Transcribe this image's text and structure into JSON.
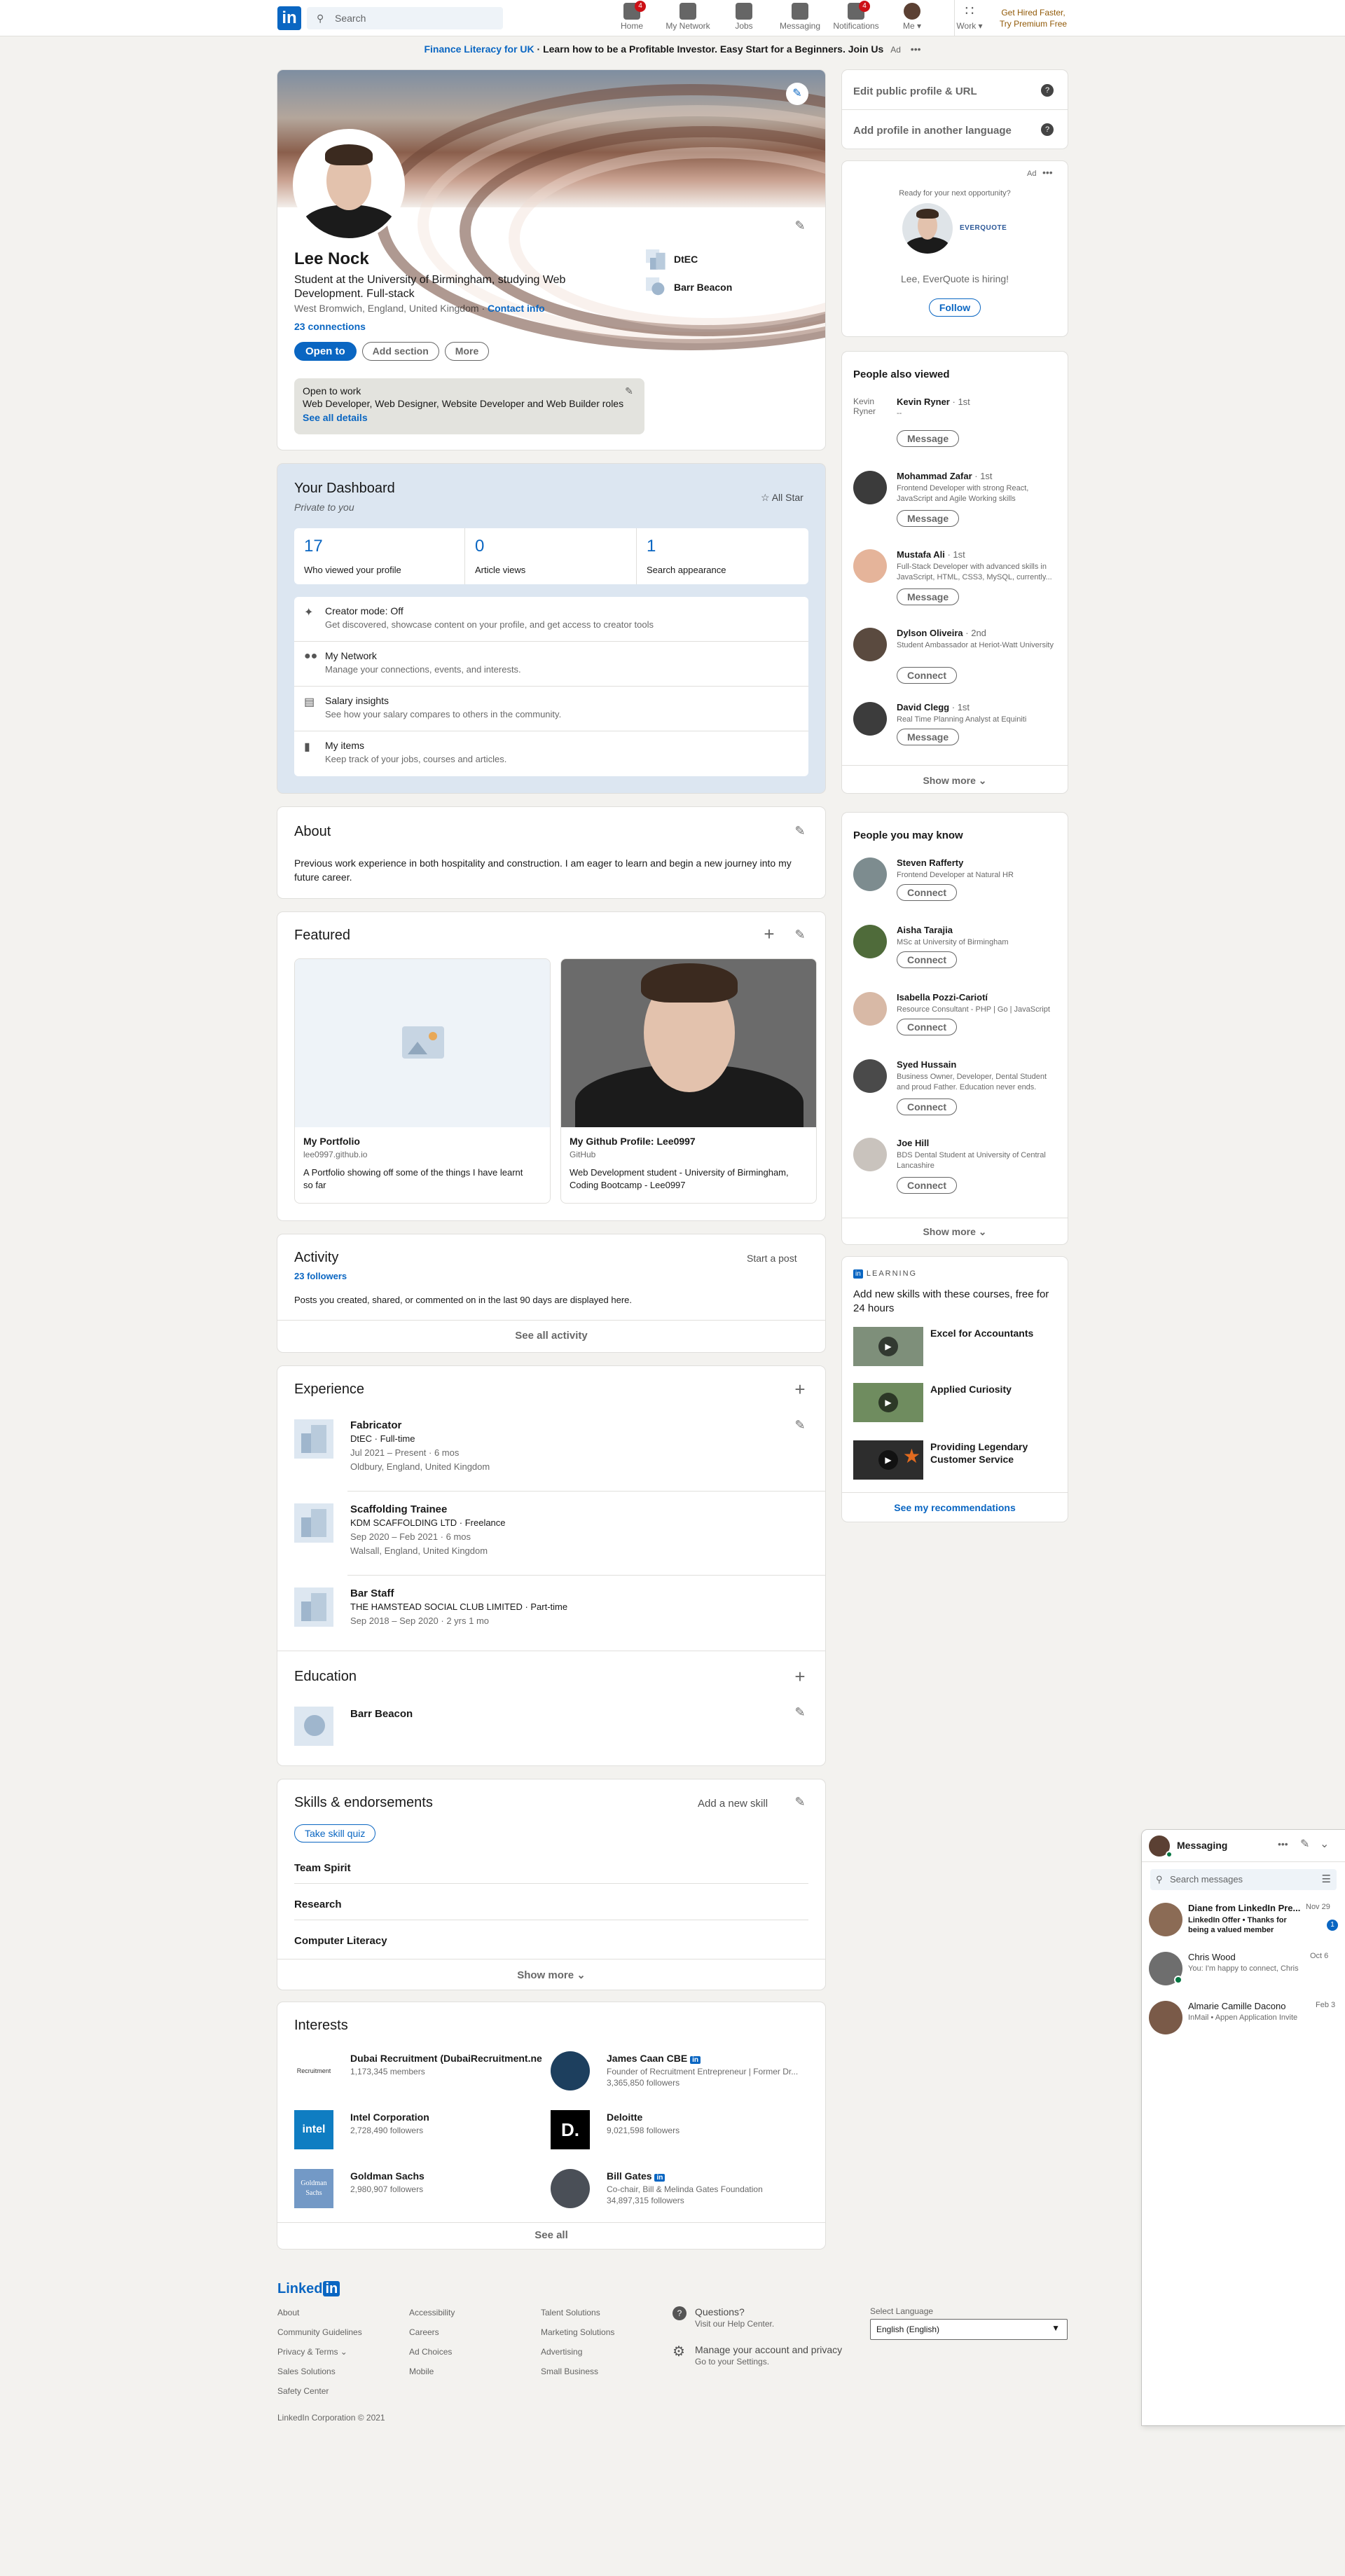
{
  "nav": {
    "search_placeholder": "Search",
    "items": [
      {
        "label": "Home",
        "badge": "4"
      },
      {
        "label": "My Network",
        "badge": ""
      },
      {
        "label": "Jobs",
        "badge": ""
      },
      {
        "label": "Messaging",
        "badge": ""
      },
      {
        "label": "Notifications",
        "badge": "4"
      },
      {
        "label": "Me ▾",
        "badge": ""
      },
      {
        "label": "Work ▾",
        "badge": ""
      }
    ],
    "premium": "Get Hired Faster, Try Premium Free"
  },
  "ad_banner": {
    "link": "Finance Literacy for UK",
    "text": " · Learn how to be a Profitable Investor. Easy Start for a Beginners. Join Us",
    "tag": "Ad",
    "more": "•••"
  },
  "profile": {
    "name": "Lee Nock",
    "headline": "Student at the University of Birmingham, studying Web Development. Full-stack",
    "location": "West Bromwich, England, United Kingdom",
    "contact_info": "Contact info",
    "connections": "23 connections",
    "open_to_btn": "Open to",
    "add_section_btn": "Add section",
    "more_btn": "More",
    "companies": [
      "DtEC",
      "Barr Beacon"
    ],
    "open_to_work": {
      "title": "Open to work",
      "roles": "Web Developer, Web Designer, Website Developer and Web Builder roles",
      "link": "See all details"
    }
  },
  "dashboard": {
    "title": "Your Dashboard",
    "subtitle": "Private to you",
    "all_star": "All Star",
    "stats": [
      {
        "value": "17",
        "label": "Who viewed your profile"
      },
      {
        "value": "0",
        "label": "Article views"
      },
      {
        "value": "1",
        "label": "Search appearance"
      }
    ],
    "items": [
      {
        "title": "Creator mode: Off",
        "desc": "Get discovered, showcase content on your profile, and get access to creator tools"
      },
      {
        "title": "My Network",
        "desc": "Manage your connections, events, and interests."
      },
      {
        "title": "Salary insights",
        "desc": "See how your salary compares to others in the community."
      },
      {
        "title": "My items",
        "desc": "Keep track of your jobs, courses and articles."
      }
    ]
  },
  "about": {
    "title": "About",
    "text": "Previous work experience in both hospitality and construction. I am eager to learn and begin a new journey into my future career."
  },
  "featured": {
    "title": "Featured",
    "items": [
      {
        "title": "My Portfolio",
        "source": "lee0997.github.io",
        "desc": "A Portfolio showing off some of the things I have learnt so far"
      },
      {
        "title": "My Github Profile: Lee0997",
        "source": "GitHub",
        "desc": "Web Development student - University of Birmingham, Coding Bootcamp - Lee0997"
      }
    ]
  },
  "activity": {
    "title": "Activity",
    "followers": "23 followers",
    "start_post": "Start a post",
    "desc": "Posts you created, shared, or commented on in the last 90 days are displayed here.",
    "see_all": "See all activity"
  },
  "experience": {
    "title": "Experience",
    "items": [
      {
        "role": "Fabricator",
        "company": "DtEC · Full-time",
        "dates": "Jul 2021 – Present · 6 mos",
        "location": "Oldbury, England, United Kingdom"
      },
      {
        "role": "Scaffolding Trainee",
        "company": "KDM SCAFFOLDING LTD · Freelance",
        "dates": "Sep 2020 – Feb 2021 · 6 mos",
        "location": "Walsall, England, United Kingdom"
      },
      {
        "role": "Bar Staff",
        "company": "THE HAMSTEAD SOCIAL CLUB LIMITED · Part-time",
        "dates": "Sep 2018 – Sep 2020 · 2 yrs 1 mo",
        "location": ""
      }
    ]
  },
  "education": {
    "title": "Education",
    "items": [
      {
        "school": "Barr Beacon"
      }
    ]
  },
  "skills": {
    "title": "Skills & endorsements",
    "add_skill": "Add a new skill",
    "quiz_btn": "Take skill quiz",
    "items": [
      "Team Spirit",
      "Research",
      "Computer Literacy"
    ],
    "show_more": "Show more ⌄"
  },
  "interests": {
    "title": "Interests",
    "items": [
      {
        "name": "Dubai Recruitment (DubaiRecruitment.ne",
        "sub": "1,173,345 members",
        "sub2": "",
        "logo_text": "Recruitment",
        "color": "#ffffff"
      },
      {
        "name": "James Caan CBE",
        "sub": "Founder of Recruitment Entrepreneur | Former Dr...",
        "sub2": "3,365,850 followers",
        "logo_text": "",
        "color": "#1d3f5e"
      },
      {
        "name": "Intel Corporation",
        "sub": "2,728,490 followers",
        "sub2": "",
        "logo_text": "intel",
        "color": "#0f7dc2"
      },
      {
        "name": "Deloitte",
        "sub": "9,021,598 followers",
        "sub2": "",
        "logo_text": "D.",
        "color": "#000000"
      },
      {
        "name": "Goldman Sachs",
        "sub": "2,980,907 followers",
        "sub2": "",
        "logo_text": "Goldman Sachs",
        "color": "#7399c6"
      },
      {
        "name": "Bill Gates",
        "sub": "Co-chair, Bill & Melinda Gates Foundation",
        "sub2": "34,897,315 followers",
        "logo_text": "",
        "color": "#4a4f57"
      }
    ],
    "see_all": "See all"
  },
  "sidebar": {
    "edit_links": [
      "Edit public profile & URL",
      "Add profile in another language"
    ],
    "ad": {
      "tag": "Ad",
      "more": "•••",
      "prompt": "Ready for your next opportunity?",
      "company_logo": "EVERQUOTE",
      "text": "Lee, EverQuote is hiring!",
      "follow": "Follow"
    },
    "people_also_viewed": {
      "title": "People also viewed",
      "people": [
        {
          "name": "Kevin Ryner",
          "degree": "· 1st",
          "desc": "--",
          "btn": "Message",
          "alt": "Kevin Ryner"
        },
        {
          "name": "Mohammad Zafar",
          "degree": "· 1st",
          "desc": "Frontend Developer with strong React, JavaScript and Agile Working skills",
          "btn": "Message",
          "alt": ""
        },
        {
          "name": "Mustafa Ali",
          "degree": "· 1st",
          "desc": "Full-Stack Developer with advanced skills in JavaScript, HTML, CSS3, MySQL, currently...",
          "btn": "Message",
          "alt": ""
        },
        {
          "name": "Dylson Oliveira",
          "degree": "· 2nd",
          "desc": "Student Ambassador at Heriot-Watt University",
          "btn": "Connect",
          "alt": ""
        },
        {
          "name": "David Clegg",
          "degree": "· 1st",
          "desc": "Real Time Planning Analyst at Equiniti",
          "btn": "Message",
          "alt": ""
        }
      ],
      "show_more": "Show more ⌄"
    },
    "people_you_may_know": {
      "title": "People you may know",
      "people": [
        {
          "name": "Steven Rafferty",
          "desc": "Frontend Developer at Natural HR",
          "btn": "Connect"
        },
        {
          "name": "Aisha Tarajia",
          "desc": "MSc at University of Birmingham",
          "btn": "Connect"
        },
        {
          "name": "Isabella Pozzi-Cariotí",
          "desc": "Resource Consultant - PHP | Go | JavaScript",
          "btn": "Connect"
        },
        {
          "name": "Syed Hussain",
          "desc": "Business Owner, Developer, Dental Student and proud Father. Education never ends.",
          "btn": "Connect"
        },
        {
          "name": "Joe Hill",
          "desc": "BDS Dental Student at University of Central Lancashire",
          "btn": "Connect"
        }
      ],
      "show_more": "Show more ⌄"
    },
    "learning": {
      "brand": "LEARNING",
      "title": "Add new skills with these courses, free for 24 hours",
      "courses": [
        "Excel for Accountants",
        "Applied Curiosity",
        "Providing Legendary Customer Service"
      ],
      "see_recs": "See my recommendations"
    }
  },
  "messaging": {
    "title": "Messaging",
    "search_placeholder": "Search messages",
    "threads": [
      {
        "name": "Diane from LinkedIn Pre...",
        "date": "Nov 29",
        "preview": "LinkedIn Offer • Thanks for being a valued member",
        "unread": "1"
      },
      {
        "name": "Chris Wood",
        "date": "Oct 6",
        "preview": "You: I'm happy to connect, Chris",
        "unread": ""
      },
      {
        "name": "Almarie Camille Dacono",
        "date": "Feb 3",
        "preview": "InMail • Appen Application Invite",
        "unread": ""
      }
    ]
  },
  "footer": {
    "logo": "Linked",
    "cols": [
      [
        "About",
        "Community Guidelines",
        "Privacy & Terms ⌄",
        "Sales Solutions",
        "Safety Center"
      ],
      [
        "Accessibility",
        "Careers",
        "Ad Choices",
        "Mobile"
      ],
      [
        "Talent Solutions",
        "Marketing Solutions",
        "Advertising",
        "Small Business"
      ]
    ],
    "help": {
      "title": "Questions?",
      "sub": "Visit our Help Center."
    },
    "settings": {
      "title": "Manage your account and privacy",
      "sub": "Go to your Settings."
    },
    "language_label": "Select Language",
    "language_value": "English (English)",
    "copyright": "LinkedIn Corporation © 2021"
  }
}
